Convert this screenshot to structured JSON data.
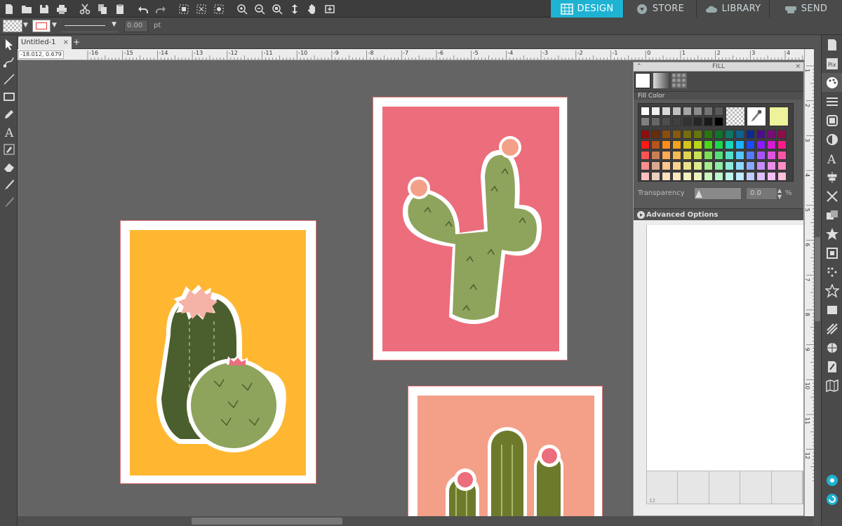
{
  "nav": {
    "design": "DESIGN",
    "store": "STORE",
    "library": "LIBRARY",
    "send": "SEND"
  },
  "toolbar2": {
    "line_width_value": "0.00",
    "line_width_unit": "pt"
  },
  "tabs": {
    "document": "Untitled-1"
  },
  "coords": {
    "x": "-18.012",
    "y": "0.679"
  },
  "ruler_top_labels": [
    "-16",
    "-15",
    "-14",
    "-13",
    "-12",
    "-11",
    "-10",
    "-9",
    "-8",
    "-7",
    "-6",
    "-5",
    "-4",
    "-3",
    "-2",
    "-1",
    "0",
    "1",
    "2",
    "3",
    "4"
  ],
  "ruler_right_labels": [
    "1",
    "2",
    "3",
    "4",
    "5",
    "6",
    "7",
    "8",
    "9",
    "10",
    "11",
    "12"
  ],
  "fill_panel": {
    "title": "FILL",
    "section": "Fill Color",
    "transparency_label": "Transparency",
    "transparency_value": "0.0",
    "transparency_unit": "%",
    "advanced_label": "Advanced Options",
    "corner_label": "12",
    "selected_color": "#eef29a"
  },
  "swatch_colors": {
    "greys_row1": [
      "#ffffff",
      "#f0f0f0",
      "#d9d9d9",
      "#c0c0c0",
      "#a6a6a6",
      "#8c8c8c",
      "#737373",
      "#595959"
    ],
    "greys_row2": [
      "#808080",
      "#666666",
      "#4d4d4d",
      "#404040",
      "#333333",
      "#262626",
      "#1a1a1a",
      "#000000"
    ],
    "hues": [
      "#ff1a1a",
      "#b5541c",
      "#ff8c1a",
      "#f2a41a",
      "#d4c51a",
      "#b8d61a",
      "#4cd61a",
      "#1ad64c",
      "#1ad6b8",
      "#1ab3ff",
      "#1a4cff",
      "#8c1aff",
      "#d61ad6",
      "#ff1a8c"
    ]
  },
  "colors": {
    "accent": "#1fb3d3",
    "card_yellow": "#ffb732",
    "card_pink": "#ec6d7c",
    "card_salmon": "#f4a088"
  }
}
